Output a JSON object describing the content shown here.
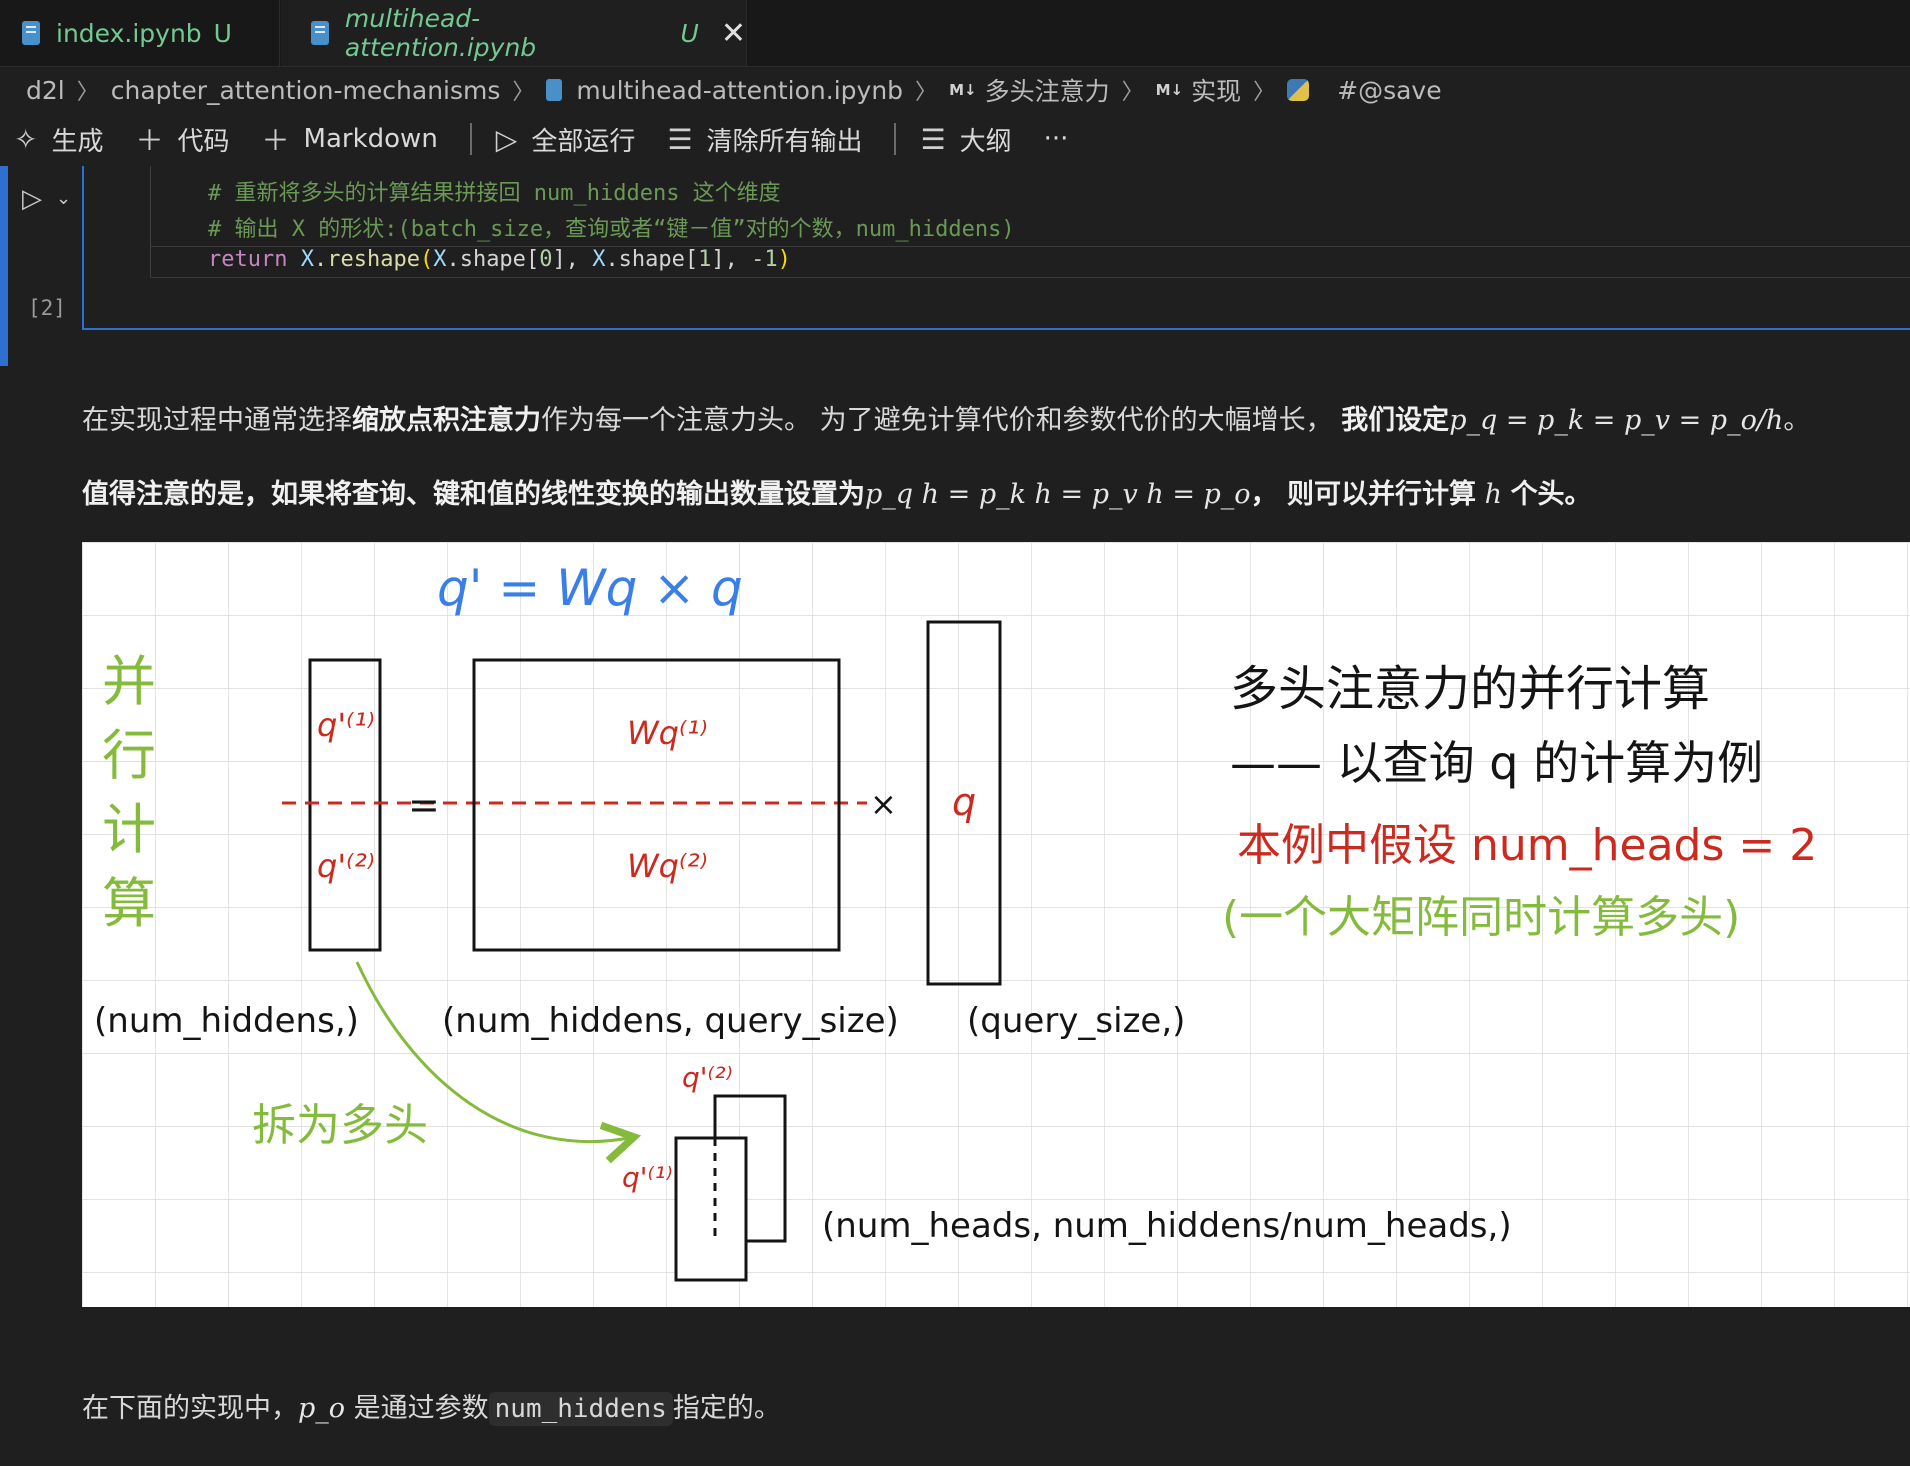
{
  "tabs": [
    {
      "label": "index.ipynb",
      "status": "U"
    },
    {
      "label": "multihead-attention.ipynb",
      "status": "U"
    }
  ],
  "breadcrumb": [
    "d2l",
    "chapter_attention-mechanisms",
    "multihead-attention.ipynb",
    "多头注意力",
    "实现",
    "#@save"
  ],
  "breadcrumb_md_icon": "M↓",
  "toolbar": {
    "generate": "生成",
    "code": "代码",
    "markdown": "Markdown",
    "run_all": "全部运行",
    "clear_outputs": "清除所有输出",
    "outline": "大纲",
    "more": "···"
  },
  "cell": {
    "exec_count": "[2]",
    "comment1": "# 重新将多头的计算结果拼接回 num_hiddens 这个维度",
    "comment2": "# 输出 X 的形状:(batch_size，查询或者“键－值”对的个数，num_hiddens)",
    "code": {
      "kw": "return",
      "x1": "X",
      "fn": ".reshape",
      "x2": "X",
      "shape1": ".shape",
      "i0": "0",
      "x3": "X",
      "shape2": ".shape",
      "i1": "1",
      "neg1": "-1"
    }
  },
  "md1": {
    "part1": "在实现过程中通常选择",
    "bold1": "缩放点积注意力",
    "part2": "作为每一个注意力头。 为了避免计算代价和参数代价的大幅增长，",
    "bold2": "我们设定",
    "math1": "p_q = p_k = p_v = p_o/h",
    "end": "。"
  },
  "md2": {
    "bold1": "值得注意的是，如果将查询、键和值的线性变换的输出数量设置为",
    "math1": "p_q h = p_k h = p_v h = p_o",
    "bold2": "， 则可以并行计算",
    "math2": "h",
    "bold3": "个头。"
  },
  "md3": {
    "part1": "在下面的实现中，",
    "math1": "p_o",
    "part2": "是通过参数",
    "code": "num_hiddens",
    "part3": "指定的。"
  },
  "figure": {
    "equation": "q' = Wq × q",
    "left_vertical": [
      "并",
      "行",
      "计",
      "算"
    ],
    "q1": "q'⁽¹⁾",
    "q2": "q'⁽²⁾",
    "w1": "Wq⁽¹⁾",
    "w2": "Wq⁽²⁾",
    "eq_sign": "=",
    "times": "×",
    "q": "q",
    "title1": "多头注意力的并行计算",
    "title2": "—— 以查询 q 的计算为例",
    "red_note": "本例中假设 num_heads = 2",
    "green_note": "(一个大矩阵同时计算多头)",
    "shape1": "(num_hiddens,)",
    "shape2": "(num_hiddens, query_size)",
    "shape3": "(query_size,)",
    "split_label": "拆为多头",
    "shape4": "(num_heads, num_hiddens/num_heads,)",
    "colors": {
      "blue": "#3a7ee8",
      "red": "#cc2a1f",
      "green": "#85bb3c",
      "ink": "#141414"
    }
  }
}
